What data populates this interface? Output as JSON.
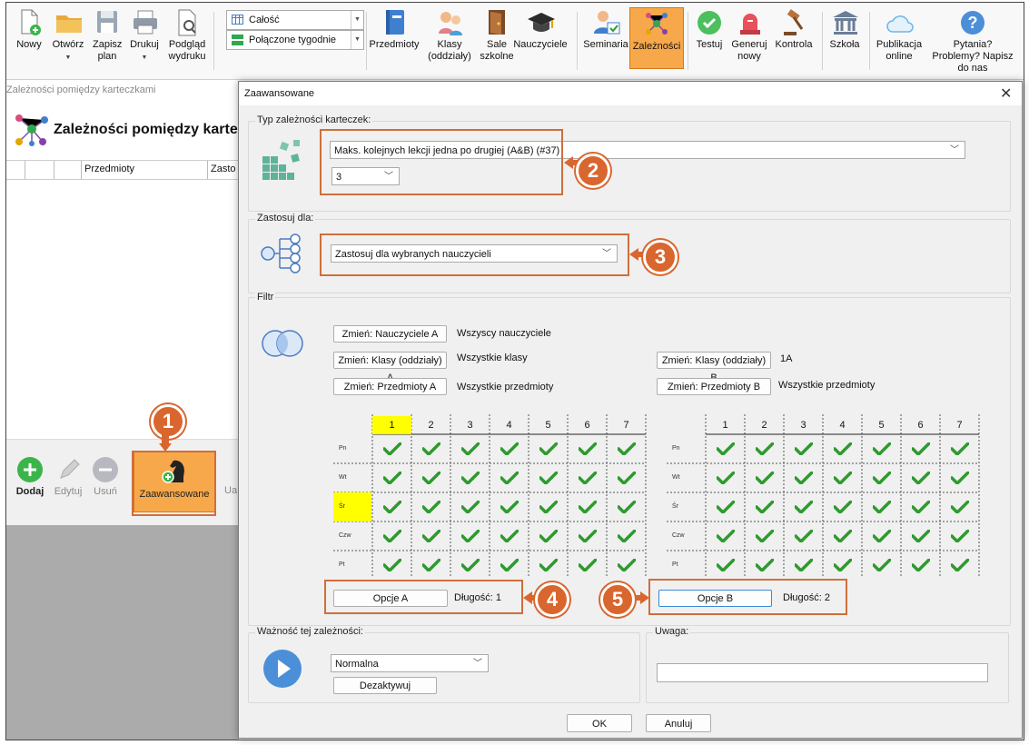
{
  "toolbar": {
    "items": [
      {
        "label": "Nowy",
        "icon": "new-doc-icon"
      },
      {
        "label": "Otwórz",
        "icon": "folder-icon",
        "dropdown": true
      },
      {
        "label": "Zapisz plan",
        "icon": "save-icon",
        "dropdown": true
      },
      {
        "label": "Drukuj",
        "icon": "printer-icon",
        "dropdown": true
      },
      {
        "label": "Podgląd wydruku",
        "icon": "preview-icon"
      },
      {
        "label": "Przedmioty",
        "icon": "book-icon"
      },
      {
        "label": "Klasy (oddziały)",
        "icon": "students-icon"
      },
      {
        "label": "Sale szkolne",
        "icon": "door-icon"
      },
      {
        "label": "Nauczyciele",
        "icon": "graduation-cap-icon"
      },
      {
        "label": "Seminaria",
        "icon": "seminar-icon"
      },
      {
        "label": "Zależności",
        "icon": "network-icon",
        "active": true
      },
      {
        "label": "Testuj",
        "icon": "check-badge-icon"
      },
      {
        "label": "Generuj nowy",
        "icon": "siren-icon"
      },
      {
        "label": "Kontrola",
        "icon": "gavel-icon"
      },
      {
        "label": "Szkoła",
        "icon": "school-building-icon"
      },
      {
        "label": "Publikacja online",
        "icon": "cloud-icon"
      },
      {
        "label": "Pytania? Problemy? Napisz do nas",
        "icon": "question-icon"
      }
    ],
    "combo1": "Całość",
    "combo2": "Połączone tygodnie"
  },
  "bgwin": {
    "title": "Zależności pomiędzy karteczkami",
    "heading": "Zależności pomiędzy karte",
    "col1": "Przedmioty",
    "col2": "Zasto",
    "buttons": [
      "Dodaj",
      "Edytuj",
      "Usuń",
      "Zaawansowane",
      "Ua"
    ]
  },
  "dialog": {
    "title": "Zaawansowane",
    "group_type": "Typ zależności karteczek:",
    "type_value": "Maks. kolejnych lekcji jedna po drugiej (A&B) (#37)",
    "count_value": "3",
    "group_apply": "Zastosuj dla:",
    "apply_value": "Zastosuj dla wybranych nauczycieli",
    "group_filter": "Filtr",
    "filter": {
      "btn_teachers_a": "Zmień: Nauczyciele A",
      "txt_teachers_a": "Wszyscy nauczyciele",
      "btn_classes_a": "Zmień: Klasy (oddziały) A",
      "txt_classes_a": "Wszystkie klasy",
      "btn_subjects_a": "Zmień: Przedmioty A",
      "txt_subjects_a": "Wszystkie przedmioty",
      "btn_classes_b": "Zmień: Klasy (oddziały) B",
      "txt_classes_b": "1A",
      "btn_subjects_b": "Zmień: Przedmioty B",
      "txt_subjects_b": "Wszystkie przedmioty"
    },
    "grid": {
      "periods": [
        "1",
        "2",
        "3",
        "4",
        "5",
        "6",
        "7"
      ],
      "days": [
        "Pn",
        "Wt",
        "Śr",
        "Czw",
        "Pt"
      ]
    },
    "options_a": "Opcje A",
    "length_a": "Długość: 1",
    "options_b": "Opcje B",
    "length_b": "Długość: 2",
    "group_weight": "Ważność tej zależności:",
    "weight_value": "Normalna",
    "deactivate": "Dezaktywuj",
    "group_note": "Uwaga:",
    "ok": "OK",
    "cancel": "Anuluj"
  },
  "callouts": [
    "1",
    "2",
    "3",
    "4",
    "5"
  ],
  "colors": {
    "accent": "#d9662e",
    "check": "#2e9a2e",
    "highlight": "#ffff00",
    "active_tool": "#f7a84a"
  }
}
